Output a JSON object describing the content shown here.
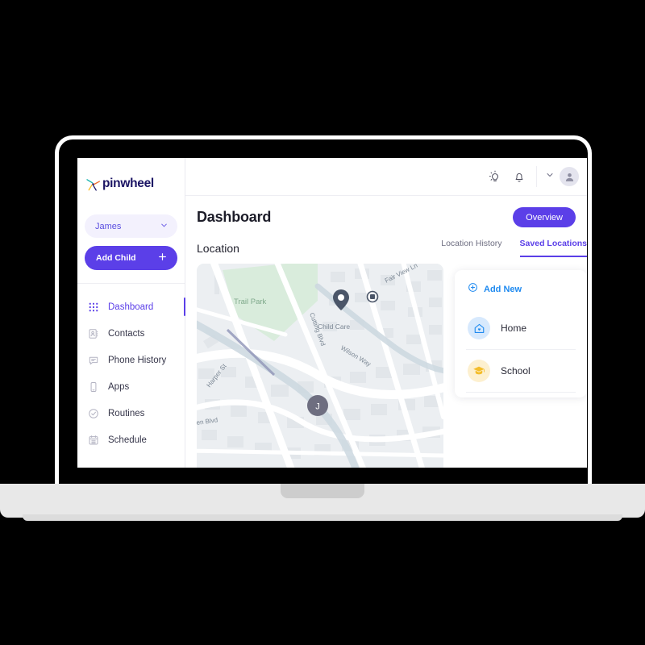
{
  "brand": {
    "logo_text": "pinwheel",
    "logo_icon": "pinwheel-logo-icon",
    "colors": {
      "primary": "#5b3fe8",
      "primary_soft": "#f3f1fd",
      "link_blue": "#1f8af0",
      "school_yellow": "#f4bd2b",
      "navy": "#1b1464"
    }
  },
  "sidebar": {
    "child_selector": {
      "name": "James",
      "chevron_icon": "chevron-down-icon"
    },
    "add_child": {
      "label": "Add Child",
      "icon": "plus-icon"
    },
    "items": [
      {
        "label": "Dashboard",
        "icon": "grid-icon",
        "active": true
      },
      {
        "label": "Contacts",
        "icon": "contact-card-icon",
        "active": false
      },
      {
        "label": "Phone History",
        "icon": "chat-bubble-icon",
        "active": false
      },
      {
        "label": "Apps",
        "icon": "mobile-phone-icon",
        "active": false
      },
      {
        "label": "Routines",
        "icon": "check-circle-icon",
        "active": false
      },
      {
        "label": "Schedule",
        "icon": "calendar-icon",
        "active": false
      }
    ]
  },
  "topbar": {
    "icons": [
      {
        "name": "lightbulb-icon"
      },
      {
        "name": "bell-icon"
      }
    ],
    "account": {
      "chevron_icon": "chevron-down-icon",
      "avatar_icon": "user-avatar-icon"
    }
  },
  "page": {
    "title": "Dashboard",
    "overview_button": "Overview",
    "section_title": "Location",
    "tabs": [
      {
        "label": "Location History",
        "active": false
      },
      {
        "label": "Saved Locations",
        "active": true
      }
    ]
  },
  "map": {
    "park_label": "Trail Park",
    "poi": [
      {
        "label": "Child Care",
        "icon": "place-pin-icon"
      },
      {
        "label": "",
        "icon": "building-icon"
      }
    ],
    "streets": [
      "Fair View Ln",
      "Wilson Way",
      "Cutting Blvd",
      "Harper St",
      "en Blvd"
    ],
    "child_marker": {
      "initial": "J",
      "color": "#6e6e80"
    }
  },
  "saved_locations": {
    "add_new": {
      "label": "Add New",
      "icon": "plus-circle-icon"
    },
    "items": [
      {
        "name": "Home",
        "icon": "home-heart-icon",
        "tone": "home"
      },
      {
        "name": "School",
        "icon": "graduation-cap-icon",
        "tone": "school"
      }
    ]
  }
}
